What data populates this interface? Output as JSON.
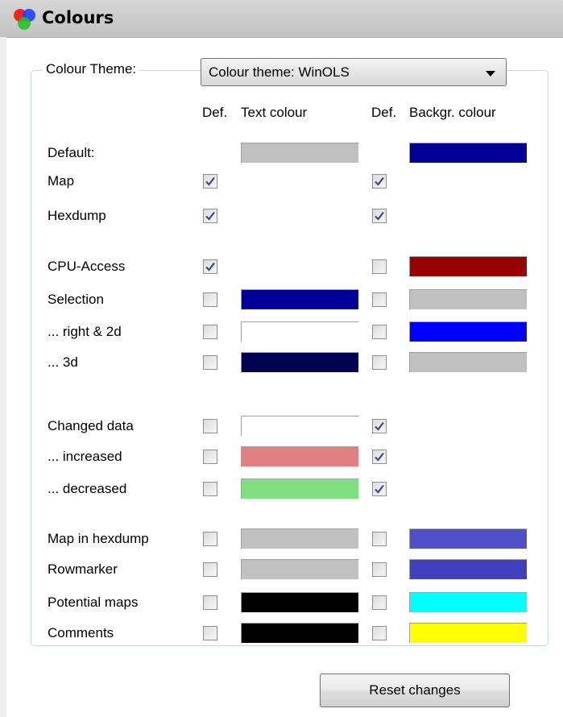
{
  "panel": {
    "title": "Colours",
    "icon": "rgb-circles-icon"
  },
  "theme": {
    "label": "Colour Theme:",
    "selected": "Colour theme: WinOLS"
  },
  "columns": {
    "def_text": "Def.",
    "text_colour": "Text colour",
    "def_back": "Def.",
    "back_colour": "Backgr. colour"
  },
  "rows": [
    {
      "label": "Default:",
      "text_def": null,
      "text_color": "#c0c0c0",
      "back_def": null,
      "back_color": "#000099"
    },
    {
      "label": "Map",
      "text_def": true,
      "text_color": null,
      "back_def": true,
      "back_color": null
    },
    {
      "label": "Hexdump",
      "text_def": true,
      "text_color": null,
      "back_def": true,
      "back_color": null
    },
    {
      "label": "CPU-Access",
      "text_def": true,
      "text_color": null,
      "back_def": false,
      "back_color": "#990000"
    },
    {
      "label": "Selection",
      "text_def": false,
      "text_color": "#000099",
      "back_def": false,
      "back_color": "#c0c0c0"
    },
    {
      "label": " ... right & 2d",
      "text_def": false,
      "text_color": "#ffffff",
      "back_def": false,
      "back_color": "#0000ff"
    },
    {
      "label": " ... 3d",
      "text_def": false,
      "text_color": "#000050",
      "back_def": false,
      "back_color": "#c0c0c0"
    },
    {
      "label": "Changed data",
      "text_def": false,
      "text_color": "#ffffff",
      "back_def": true,
      "back_color": null
    },
    {
      "label": " ... increased",
      "text_def": false,
      "text_color": "#e08080",
      "back_def": true,
      "back_color": null
    },
    {
      "label": " ... decreased",
      "text_def": false,
      "text_color": "#80e080",
      "back_def": true,
      "back_color": null
    },
    {
      "label": "Map in hexdump",
      "text_def": false,
      "text_color": "#c0c0c0",
      "back_def": false,
      "back_color": "#5050c8"
    },
    {
      "label": "Rowmarker",
      "text_def": false,
      "text_color": "#c0c0c0",
      "back_def": false,
      "back_color": "#4040c0"
    },
    {
      "label": "Potential maps",
      "text_def": false,
      "text_color": "#000000",
      "back_def": false,
      "back_color": "#00ffff"
    },
    {
      "label": "Comments",
      "text_def": false,
      "text_color": "#000000",
      "back_def": false,
      "back_color": "#ffff00"
    }
  ],
  "reset_button": {
    "label": "Reset changes"
  }
}
